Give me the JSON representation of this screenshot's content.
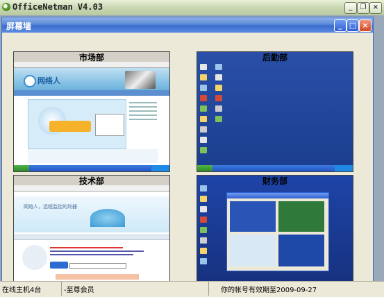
{
  "window": {
    "title": "OfficeNetman V4.03",
    "buttons": {
      "minimize": "_",
      "restore": "❐",
      "close": "×"
    }
  },
  "inner_window": {
    "title": "屏幕墙",
    "buttons": {
      "minimize": "_",
      "maximize": "□",
      "close": "×"
    }
  },
  "screens": [
    {
      "label": "市场部"
    },
    {
      "label": "后勤部"
    },
    {
      "label": "技术部"
    },
    {
      "label": "财务部"
    }
  ],
  "screen1": {
    "site_logo": "网络人"
  },
  "screen3": {
    "banner": "网络人，远程监控的利器"
  },
  "status": {
    "online": "在线主机4台",
    "member": "-至尊会员",
    "expire": "你的帐号有效期至2009-09-27"
  },
  "colors": {
    "inner_title": "#3b6ccf",
    "desktop_blue": "#1b3e8e"
  }
}
